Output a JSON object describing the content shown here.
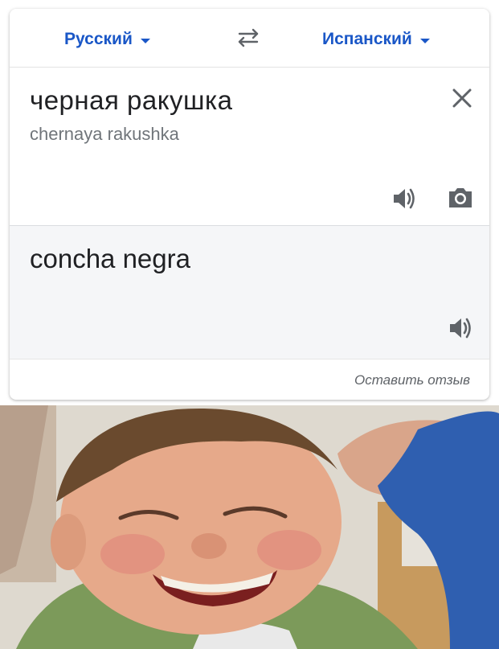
{
  "language_bar": {
    "source_language": "Русский",
    "target_language": "Испанский"
  },
  "input": {
    "text": "черная ракушка",
    "transliteration": "chernaya rakushka"
  },
  "output": {
    "text": "concha negra"
  },
  "footer": {
    "feedback_label": "Оставить отзыв"
  },
  "colors": {
    "accent": "#1a57c7",
    "icon_gray": "#5f6368",
    "output_bg": "#f5f6f8"
  },
  "icons": [
    "chevron-down-icon",
    "swap-languages-icon",
    "close-icon",
    "speaker-icon",
    "camera-icon"
  ]
}
